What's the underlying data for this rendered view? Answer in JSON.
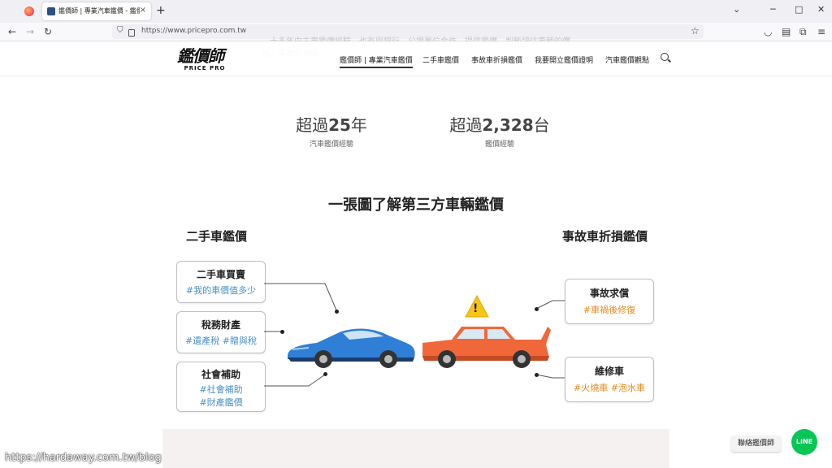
{
  "browser": {
    "tab_title": "鑑價師 | 專業汽車鑑價 - 鑑價師",
    "url": "https://www.pricepro.com.tw",
    "new_tab": "+",
    "close_tab": "×"
  },
  "ghost_text": "…十多年中古車鑑價經驗，也有與銀行、公證單位合作，提供鑑價、判斷評估車輛的價值、事故和損傷…",
  "header": {
    "logo_cn": "鑑價師",
    "logo_en": "PRICE PRO",
    "nav": [
      "鑑價師 | 專業汽車鑑價",
      "二手車鑑價",
      "事故車折損鑑價",
      "我要開立鑑價證明",
      "汽車鑑價觀點"
    ]
  },
  "stats": [
    {
      "prefix": "超過",
      "value": "25",
      "suffix": "年",
      "label": "汽車鑑價經驗"
    },
    {
      "prefix": "超過",
      "value": "2,328",
      "suffix": "台",
      "label": "鑑價經驗"
    }
  ],
  "infographic": {
    "title": "一張圖了解第三方車輛鑑價",
    "left_heading": "二手車鑑價",
    "right_heading": "事故車折損鑑價",
    "left_cards": [
      {
        "title": "二手車買賣",
        "tags": [
          "#我的車價值多少"
        ]
      },
      {
        "title": "稅務財產",
        "tags": [
          "#遺產稅 #贈與稅"
        ]
      },
      {
        "title": "社會補助",
        "tags": [
          "#社會補助",
          "#財產鑑價"
        ]
      }
    ],
    "right_cards": [
      {
        "title": "事故求償",
        "tags": [
          "#車禍後修復"
        ]
      },
      {
        "title": "維修車",
        "tags": [
          "#火燒車 #泡水車"
        ]
      }
    ],
    "warning_symbol": "!"
  },
  "floating": {
    "contact_label": "聯絡鑑價師",
    "line_label": "LINE"
  },
  "watermark": "https://hardaway.com.tw/blog",
  "colors": {
    "blue_car": "#2f7fd6",
    "orange_car": "#f0683a",
    "tag_blue": "#4a90c8",
    "tag_orange": "#e8891c",
    "line_green": "#06c755"
  }
}
